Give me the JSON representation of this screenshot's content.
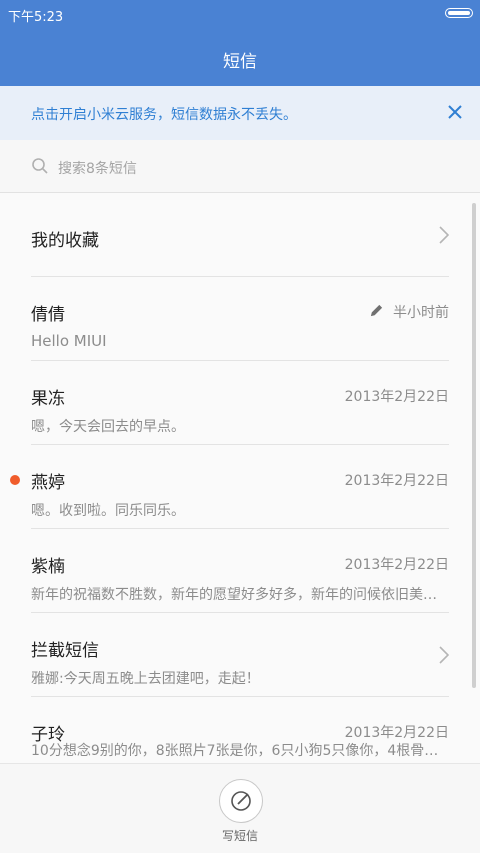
{
  "status_bar": {
    "time": "下午5:23"
  },
  "header": {
    "title": "短信"
  },
  "banner": {
    "text": "点击开启小米云服务，短信数据永不丢失。",
    "accent": "#2f7fd3"
  },
  "search": {
    "placeholder": "搜索8条短信"
  },
  "list": {
    "favorites": {
      "label": "我的收藏"
    },
    "conversations": [
      {
        "name": "倩倩",
        "preview": "Hello MIUI",
        "time": "半小时前",
        "draft": true
      },
      {
        "name": "果冻",
        "preview": "嗯，今天会回去的早点。",
        "time": "2013年2月22日"
      },
      {
        "name": "燕婷",
        "preview": "嗯。收到啦。同乐同乐。",
        "time": "2013年2月22日",
        "unread": true
      },
      {
        "name": "紫楠",
        "preview": "新年的祝福数不胜数，新年的愿望好多好多，新年的问候依旧美…",
        "time": "2013年2月22日"
      },
      {
        "name": "拦截短信",
        "preview": "雅娜:今天周五晚上去团建吧，走起！"
      },
      {
        "name": "子玲",
        "preview": "10分想念9别的你，8张照片7张是你，6只小狗5只像你，4根骨…",
        "time": "2013年2月22日"
      }
    ]
  },
  "bottom": {
    "compose_label": "写短信"
  },
  "colors": {
    "header": "#4a82d3",
    "unread": "#f05c2b"
  }
}
